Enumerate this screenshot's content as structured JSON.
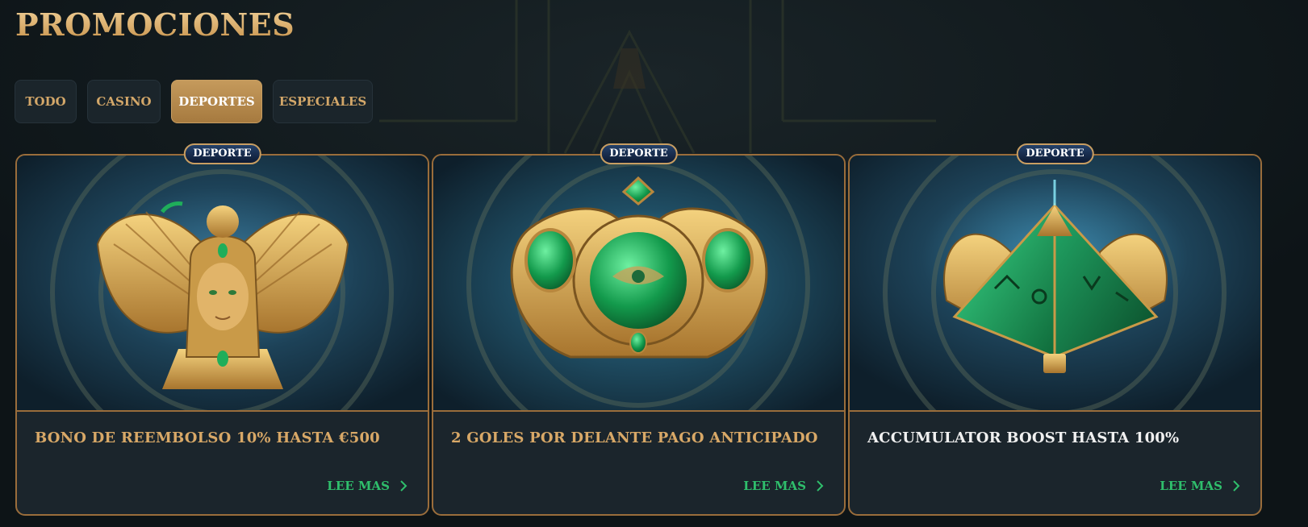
{
  "page": {
    "title": "PROMOCIONES"
  },
  "tabs": [
    {
      "label": "TODO",
      "active": false
    },
    {
      "label": "CASINO",
      "active": false
    },
    {
      "label": "DEPORTES",
      "active": true
    },
    {
      "label": "ESPECIALES",
      "active": false
    }
  ],
  "cards": [
    {
      "badge": "DEPORTE",
      "title": "BONO DE REEMBOLSO 10% HASTA €500",
      "read_more": "LEE MAS",
      "image": "winged-pharaoh-queen",
      "title_color": "gold"
    },
    {
      "badge": "DEPORTE",
      "title": "2 GOLES POR DELANTE PAGO ANTICIPADO",
      "read_more": "LEE MAS",
      "image": "eye-of-horus-amulet",
      "title_color": "gold"
    },
    {
      "badge": "DEPORTE",
      "title": "ACCUMULATOR BOOST HASTA 100%",
      "read_more": "LEE MAS",
      "image": "emerald-pyramid",
      "title_color": "white"
    }
  ],
  "colors": {
    "background": "#0f1619",
    "gold": "#d4a866",
    "card_border": "#9a6d3b",
    "read_more": "#2fbf6c",
    "active_tab": "#b88a4d",
    "badge_bg": "#1a3158"
  },
  "icons": {
    "read_more": "chevron-right-icon"
  }
}
